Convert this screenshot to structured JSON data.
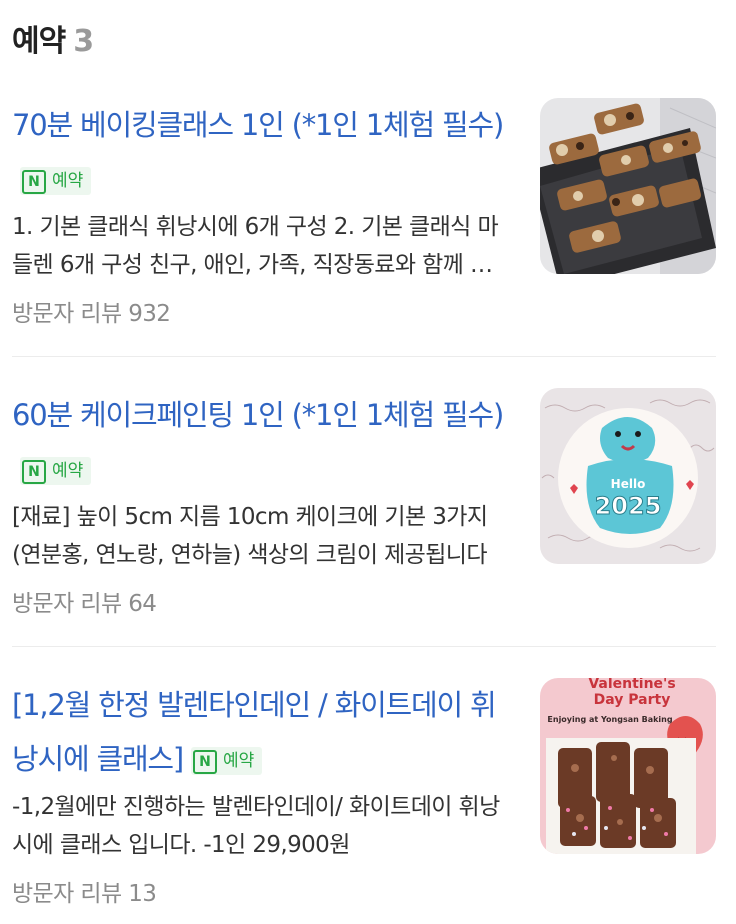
{
  "header": {
    "title": "예약",
    "count": "3"
  },
  "badge": {
    "icon": "N",
    "label": "예약"
  },
  "items": [
    {
      "title": "70분 베이킹클래스 1인 (*1인 1체험 필수)",
      "desc": "1. 기본 클래식 휘낭시에 6개 구성 2. 기본 클래식 마들렌 6개 구성 친구, 애인, 가족, 직장동료와 함께 베이킹을 즐겨보세요",
      "review": "방문자 리뷰 932",
      "image": "baked-financiers-on-tray"
    },
    {
      "title": "60분 케이크페인팅 1인 (*1인 1체험 필수)",
      "desc": "[재료] 높이 5cm 지름 10cm 케이크에 기본 3가지(연분홍, 연노랑, 연하늘) 색상의 크림이 제공됩니다",
      "review": "방문자 리뷰 64",
      "image": "painted-cake-hello-2025"
    },
    {
      "title": "[1,2월 한정 발렌타인데인 / 화이트데이 휘낭시에 클래스]",
      "desc": "-1,2월에만 진행하는 발렌타인데이/ 화이트데이 휘낭시에 클래스 입니다. -1인 29,900원",
      "review": "방문자 리뷰 13",
      "image": "valentine-chocolate-financiers",
      "image_caption": {
        "line1": "Valentine's",
        "line2": "Day Party",
        "line3": "Enjoying at Yongsan Baking"
      }
    }
  ],
  "colors": {
    "title": "#2f64c2",
    "badge": "#28a745",
    "muted": "#8b8b8b"
  }
}
